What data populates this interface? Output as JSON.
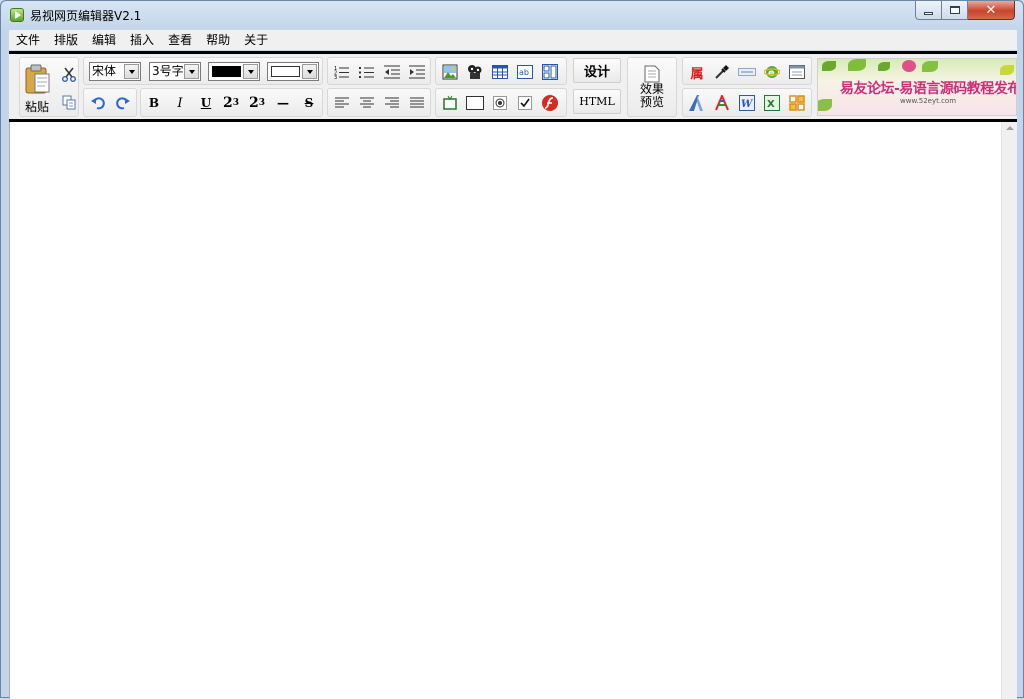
{
  "window": {
    "title": "易视网页编辑器V2.1",
    "minimize": "minimize",
    "maximize": "maximize",
    "close": "✕"
  },
  "menu": [
    "文件",
    "排版",
    "编辑",
    "插入",
    "查看",
    "帮助",
    "关于"
  ],
  "toolbar": {
    "paste_label": "粘贴",
    "font_name": "宋体",
    "font_size": "3号字",
    "text_color": "#000000",
    "bg_color": "#ffffff",
    "bold": "B",
    "italic": "I",
    "underline": "U",
    "superscript_base": "2",
    "superscript_exp": "3",
    "subscript_base": "2",
    "subscript_exp": "3",
    "hr": "—",
    "strike": "S",
    "design_label": "设计",
    "html_label": "HTML",
    "preview_label_line1": "效果",
    "preview_label_line2": "预览",
    "attr_label": "属"
  },
  "banner": {
    "text": "易友论坛-易语言源码教程发布社区",
    "url": "www.52eyt.com"
  },
  "icons": {
    "app": "app-icon",
    "paste": "clipboard-icon",
    "cut": "scissors-icon",
    "copy": "copy-icon",
    "undo": "undo-icon",
    "redo": "redo-icon"
  }
}
